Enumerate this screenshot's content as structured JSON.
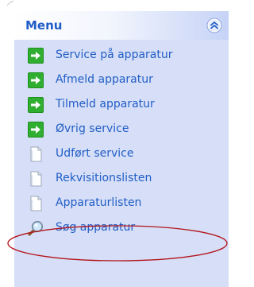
{
  "panel": {
    "title": "Menu",
    "collapse_icon": "chevron-double-up-icon"
  },
  "colors": {
    "panel_bg": "#d6dff7",
    "title_text": "#215dc6",
    "item_text": "#215dc6",
    "arrow_icon_green": "#1e9e1e",
    "highlight_ellipse": "#b3141b"
  },
  "items": [
    {
      "label": "Service på apparatur",
      "icon": "green-arrow-icon"
    },
    {
      "label": "Afmeld apparatur",
      "icon": "green-arrow-icon"
    },
    {
      "label": "Tilmeld apparatur",
      "icon": "green-arrow-icon"
    },
    {
      "label": "Øvrig service",
      "icon": "green-arrow-icon"
    },
    {
      "label": "Udført service",
      "icon": "document-icon"
    },
    {
      "label": "Rekvisitionslisten",
      "icon": "document-icon"
    },
    {
      "label": "Apparaturlisten",
      "icon": "document-icon",
      "highlighted": true
    },
    {
      "label": "Søg apparatur",
      "icon": "search-icon"
    }
  ]
}
